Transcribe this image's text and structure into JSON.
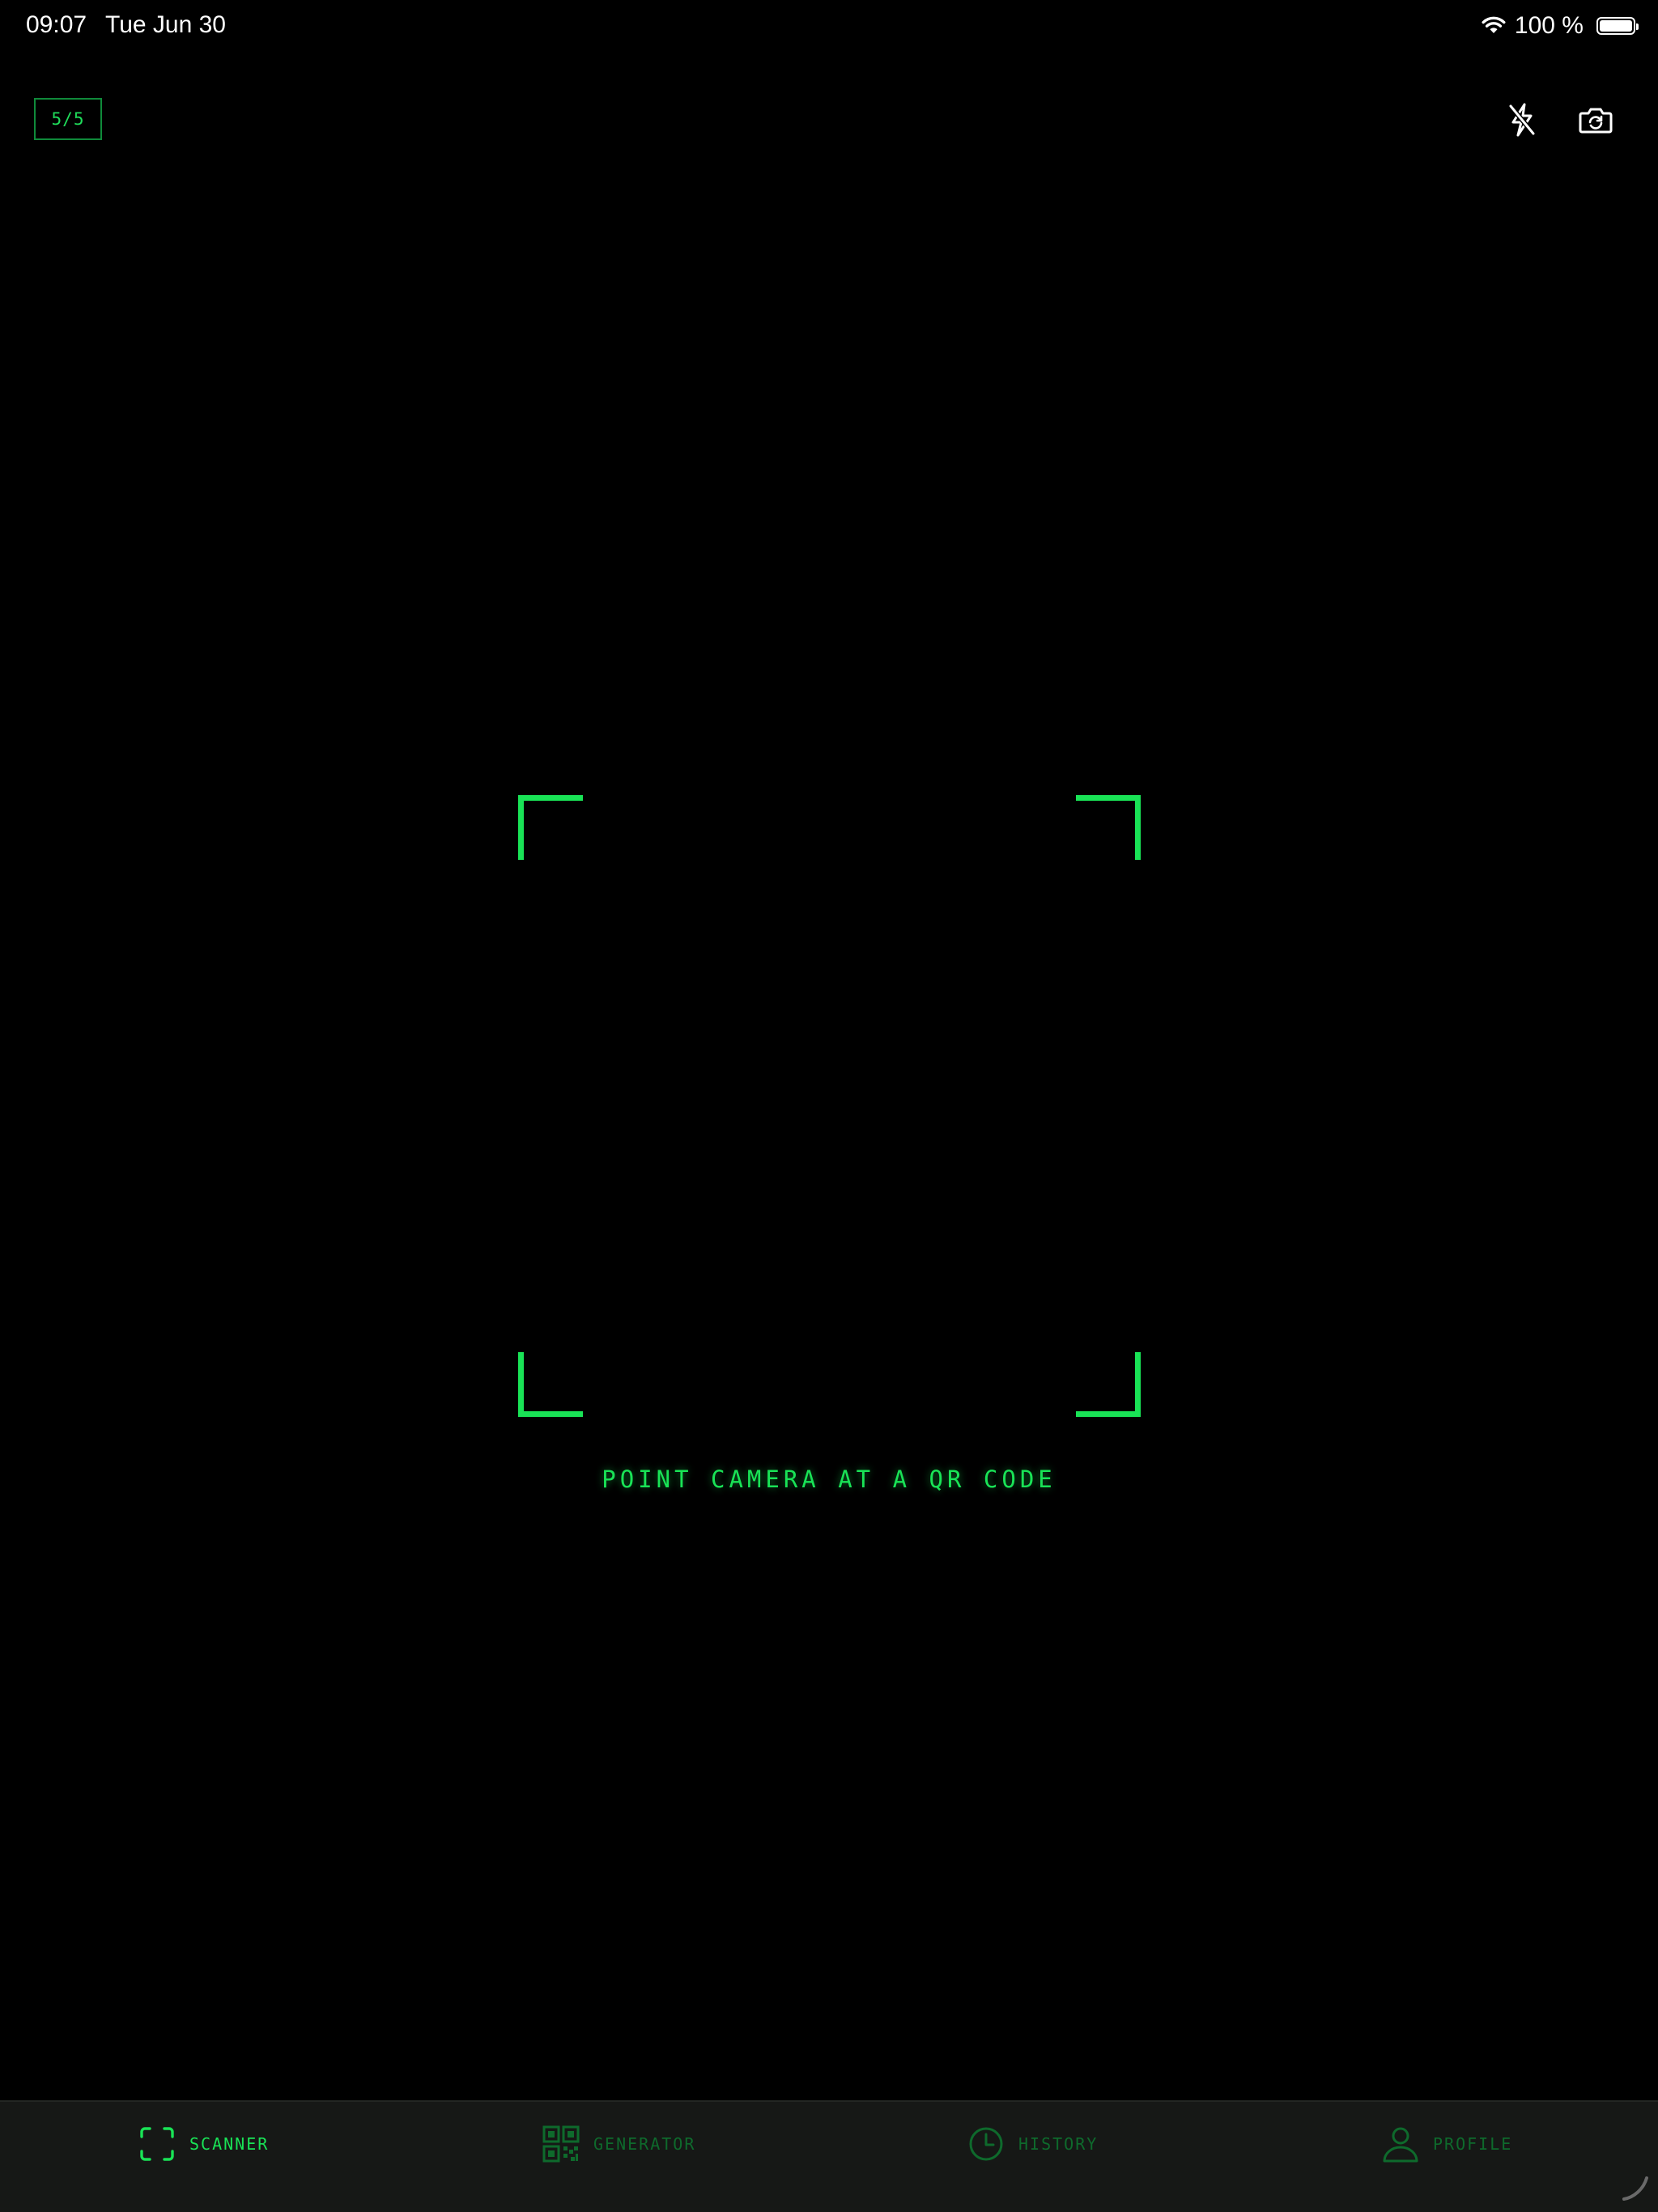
{
  "status_bar": {
    "time": "09:07",
    "date": "Tue Jun 30",
    "battery_text": "100 %",
    "battery_level": 1.0,
    "icons": [
      "wifi-icon",
      "battery-icon"
    ]
  },
  "scanner": {
    "counter": "5/5",
    "instruction": "POINT CAMERA AT A QR CODE",
    "top_icons": [
      "flash-off-icon",
      "camera-flip-icon"
    ]
  },
  "tab_bar": {
    "tabs": [
      {
        "label": "SCANNER",
        "icon": "scan-frame-icon",
        "active": true
      },
      {
        "label": "GENERATOR",
        "icon": "qr-code-icon",
        "active": false
      },
      {
        "label": "HISTORY",
        "icon": "clock-icon",
        "active": false
      },
      {
        "label": "PROFILE",
        "icon": "person-icon",
        "active": false
      }
    ]
  },
  "colors": {
    "background": "#000000",
    "accent": "#19e356",
    "accent_dim": "#0e6a2c",
    "tab_bar_bg": "#161816"
  }
}
